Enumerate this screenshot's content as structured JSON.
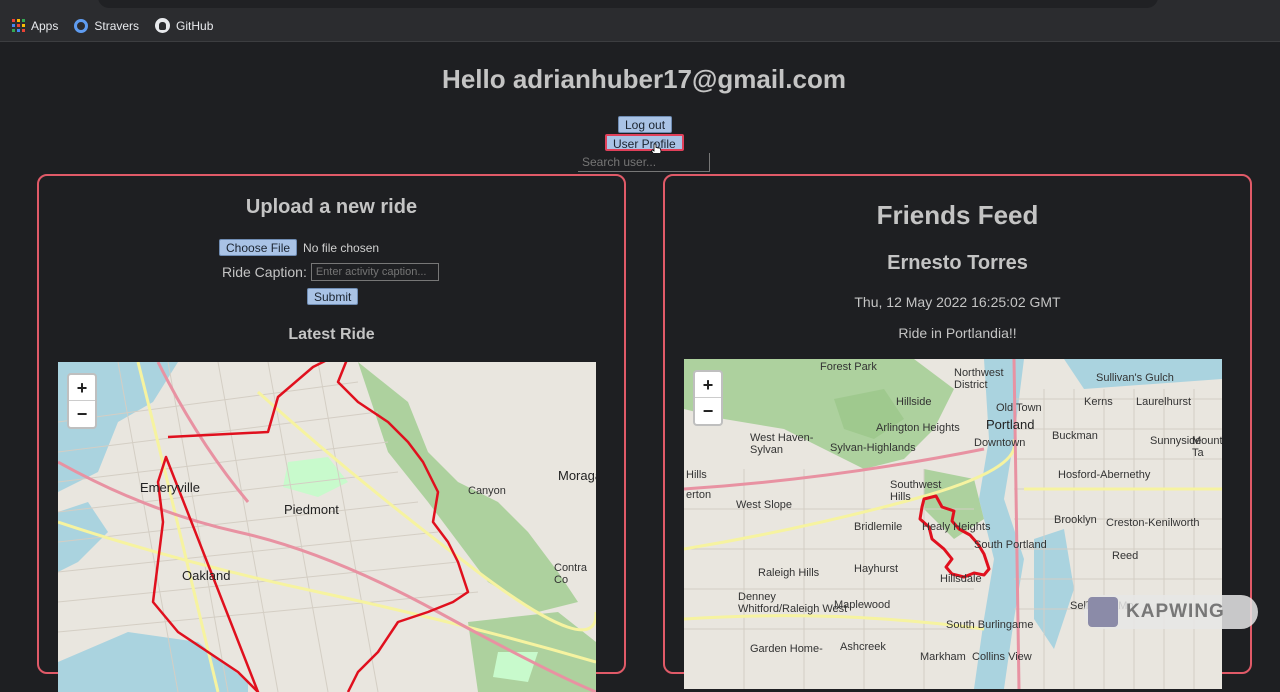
{
  "bookmarks": [
    {
      "label": "Apps",
      "icon": "apps-grid-icon"
    },
    {
      "label": "Stravers",
      "icon": "gear-icon"
    },
    {
      "label": "GitHub",
      "icon": "github-icon"
    }
  ],
  "header": {
    "greeting": "Hello adrianhuber17@gmail.com",
    "logout_label": "Log out",
    "profile_label": "User Profile",
    "search_placeholder": "Search user..."
  },
  "upload": {
    "title": "Upload a new ride",
    "choose_file_label": "Choose File",
    "file_status": "No file chosen",
    "caption_label": "Ride Caption:",
    "caption_placeholder": "Enter activity caption...",
    "submit_label": "Submit",
    "latest_title": "Latest Ride"
  },
  "left_map": {
    "zoom_in": "+",
    "zoom_out": "−",
    "labels": [
      "Emeryville",
      "Piedmont",
      "Oakland",
      "Canyon",
      "Moraga",
      "Contra Co"
    ]
  },
  "feed": {
    "title": "Friends Feed",
    "friend_name": "Ernesto Torres",
    "date": "Thu, 12 May 2022 16:25:02 GMT",
    "caption": "Ride in Portlandia!!"
  },
  "right_map": {
    "zoom_in": "+",
    "zoom_out": "−",
    "labels": [
      "Forest Park",
      "Northwest District",
      "Sullivan's Gulch",
      "Kerns",
      "Laurelhurst",
      "Hillside",
      "Old Town",
      "Arlington Heights",
      "Portland",
      "Buckman",
      "West Haven-Sylvan",
      "Sylvan-Highlands",
      "Downtown",
      "Sunnyside",
      "Mount Ta",
      "Hills",
      "Southwest Hills",
      "Hosford-Abernethy",
      "erton",
      "West Slope",
      "Bridlemile",
      "Healy Heights",
      "Brooklyn",
      "Creston-Kenilworth",
      "South Portland",
      "Reed",
      "Hayhurst",
      "Raleigh Hills",
      "Hillsdale",
      "Denney Whitford/Raleigh West",
      "Maplewood",
      "Sellwood-Mo",
      "South Burlingame",
      "Ashcreek",
      "Garden Home-",
      "Markham",
      "Collins View"
    ]
  },
  "watermark": "KAPWING",
  "colors": {
    "background": "#1e1f22",
    "panel_border": "#e05a68",
    "button_bg": "#a9c3e6",
    "route": "#e0101e"
  }
}
